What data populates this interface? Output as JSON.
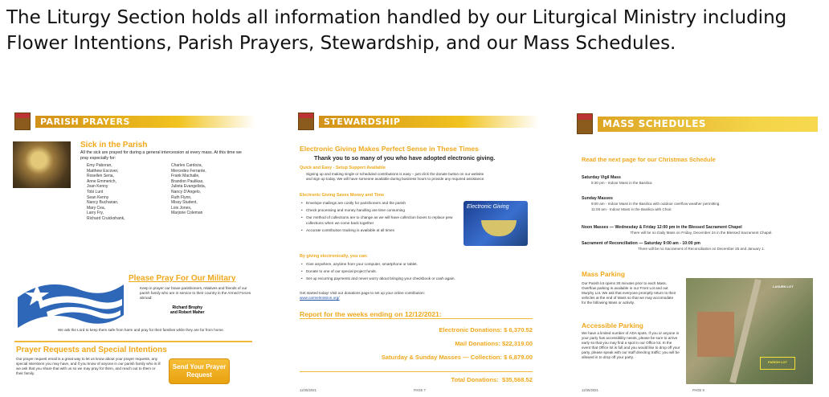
{
  "intro": "The Liturgy Section holds all information handled by our Liturgical Ministry including Flower Intentions, Parish Prayers, Stewardship, and our Mass Schedules.",
  "accent_color": "#f0a81c",
  "pages": {
    "prayers": {
      "banner": "PARISH PRAYERS",
      "sick_title": "Sick in the Parish",
      "sick_intro": "All the sick are prayed for during a general intercession at every mass. At this time we pray especially for:",
      "names_left": [
        "Emy Paboran,",
        "Matthew Escover,",
        "Rosellen Sena,",
        "Anne Emmerich,",
        "Joan Kenny",
        "Tobi Lunt",
        "Sean Kenny",
        "Nancy Buchanan,",
        "Mary Cea,",
        "Larry Fry,",
        "Richard Cruickshank,"
      ],
      "names_right": [
        "Charles Cardoza,",
        "Mercedes Ferrante,",
        "Frank Machalle,",
        "Brandon Paulikas,",
        "Julieta Evangelista,",
        "Nancy D'Angelo,",
        "Ruth Flynn,",
        "Missy Student,",
        "Lois Jones,",
        "Marjorie Coleman"
      ],
      "military_title": "Please Pray For Our Military",
      "military_body": "Keep in prayer our brave parishioners, relatives and friends of our parish family who are in service to their country in the Armed Forces abroad:",
      "military_names": [
        "Richard Brophy",
        "and Robert Maher"
      ],
      "military_close": "We ask the Lord to keep them safe from harm and pray for their families while they are far from home.",
      "requests_title": "Prayer Requests and Special Intentions",
      "requests_body": "Our prayer request email is a great way to let us know about your prayer requests, any special intentions you may have, and if you know of anyone in our parish family who is ill we ask that you share that with us so we may pray for them, and reach out to them or their family.",
      "send_button": "Send Your Prayer Request"
    },
    "stewardship": {
      "banner": "STEWARDSHIP",
      "title": "Electronic Giving Makes Perfect Sense in These Times",
      "thank": "Thank you to so many of you who have adopted electronic giving.",
      "quick_title": "Quick and Easy - Setup Support Available",
      "quick_body": "Signing up and making single or scheduled contributions is easy – just click the donate button on our website and sign up today. We will have someone available during business hours to provide any required assistance.",
      "saves_title": "Electronic Giving Saves Money and Time",
      "saves_bullets": [
        "Envelope mailings are costly for parishioners and the parish",
        "Check processing and money handling are time consuming",
        "Our method of collections are to change as we will have collection boxes to replace pew collections when we come back together",
        "Accurate contribution tracking is available at all times"
      ],
      "egift_label": "Electronic Giving",
      "can_title": "By giving electronically, you can:",
      "can_bullets": [
        "Give anywhere, anytime from your computer, smartphone or tablet.",
        "Donate to one of our special project funds.",
        "Set up recurring payments and never worry about bringing your checkbook or cash again."
      ],
      "started": "Get started today! Visit our donations page to set up your online contribution:",
      "link": "www.carmelmission.org/",
      "report_title": "Report for the weeks ending on 12/12/2021:",
      "donations": [
        {
          "label": "Electronic Donations:",
          "amount": "$ 6,370.52"
        },
        {
          "label": "Mail Donations:",
          "amount": "$22,319.00"
        },
        {
          "label": "Saturday & Sunday Masses — Collection:",
          "amount": "$ 6,879.00"
        }
      ],
      "total_label": "Total Donations:",
      "total_amount": "$35,568.52",
      "footer_date": "12/25/2021",
      "footer_page": "PAGE 7"
    },
    "mass": {
      "banner": "MASS SCHEDULES",
      "xmas": "Read the next page for our Christmas Schedule",
      "vigil_title": "Saturday Vigil Mass",
      "vigil_line": "5:30 pm - Indoor Mass in the Basilica",
      "sunday_title": "Sunday Masses",
      "sunday_lines": [
        "9:00 am - Indoor Mass in the Basilica with outdoor overflow weather permitting.",
        "11:00 am - Indoor Mass in the Basilica with Choir."
      ],
      "noon_title": "Noon Masses — Wednesday & Friday 12:00 pm in the Blessed Sacrament Chapel",
      "noon_note": "There will be no Daily Mass on Friday, December 24 in the Blessed Sacrament Chapel.",
      "recon_title": "Sacrament of Reconciliation — Saturday 9:00 am - 10:00 pm",
      "recon_note": "There will be no Sacrament of Reconciliation on December 25 and January 1.",
      "parking_title": "Mass Parking",
      "parking_body": "Our Parish lot opens 30 minutes prior to each Mass. Overflow parking is available in our Front Lot and out Murphy Lot. We ask that everyone promptly return to their vehicles at the end of Mass so that we may accomodate for the following Mass or activity.",
      "access_title": "Accessible Parking",
      "access_body": "We have a limited number of ADA spots. If you or anyone in your party has accessibility needs, please be sure to arrive early so that you may find a spot in our Office lot. In the event that Office lot is full and you would like to drop off your party, please speak with our staff directing traffic; you will be allowed in to drop off your party.",
      "map_label_top": "LASUEN LOT",
      "map_label_lot": "PARISH LOT",
      "footer_date": "12/25/2021",
      "footer_page": "PAGE 8"
    }
  }
}
